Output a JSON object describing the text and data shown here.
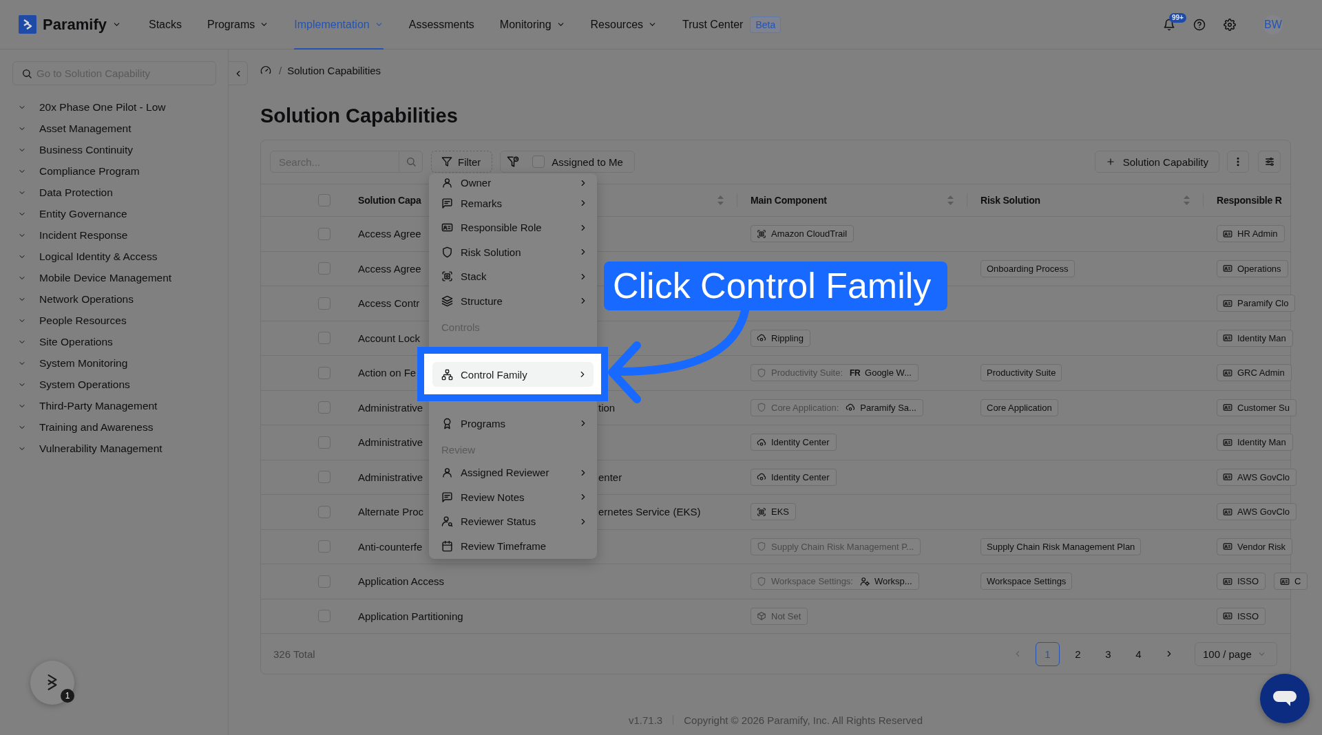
{
  "top_nav": {
    "brand": "Paramify",
    "items": [
      {
        "label": "Stacks",
        "has_menu": false,
        "selected": false
      },
      {
        "label": "Programs",
        "has_menu": true,
        "selected": false
      },
      {
        "label": "Implementation",
        "has_menu": true,
        "selected": true
      },
      {
        "label": "Assessments",
        "has_menu": false,
        "selected": false
      },
      {
        "label": "Monitoring",
        "has_menu": true,
        "selected": false
      },
      {
        "label": "Resources",
        "has_menu": true,
        "selected": false
      },
      {
        "label": "Trust Center",
        "has_menu": false,
        "selected": false,
        "badge": "Beta"
      }
    ],
    "notifications": "99+",
    "avatar": "BW"
  },
  "sidebar": {
    "search": {
      "placeholder": "Go to Solution Capability"
    },
    "items": [
      "20x Phase One Pilot - Low",
      "Asset Management",
      "Business Continuity",
      "Compliance Program",
      "Data Protection",
      "Entity Governance",
      "Incident Response",
      "Logical Identity & Access",
      "Mobile Device Management",
      "Network Operations",
      "People Resources",
      "Site Operations",
      "System Monitoring",
      "System Operations",
      "Third-Party Management",
      "Training and Awareness",
      "Vulnerability Management"
    ]
  },
  "breadcrumb": {
    "separator": "/",
    "current": "Solution Capabilities"
  },
  "page_title": "Solution Capabilities",
  "toolbar": {
    "search": {
      "placeholder": "Search..."
    },
    "filter": "Filter",
    "assigned_to_me": {
      "label": "Assigned to Me",
      "checked": false
    },
    "add_button": "Solution Capability"
  },
  "table": {
    "all_selected": false,
    "columns": [
      {
        "label": "Solution Capa",
        "sortable": true
      },
      {
        "label": "Main Component",
        "sortable": true
      },
      {
        "label": "Risk Solution",
        "sortable": true
      },
      {
        "label": "Responsible R",
        "sortable": false
      }
    ],
    "rows": [
      {
        "selected": false,
        "name": "Access Agree",
        "main_component": {
          "kind": "stack",
          "label": "Amazon CloudTrail"
        },
        "responsible": [
          "HR Admin"
        ]
      },
      {
        "selected": false,
        "name": "Access Agree",
        "risk_solution": "Onboarding Process",
        "responsible": [
          "Operations"
        ]
      },
      {
        "selected": false,
        "name": "Access Contr",
        "responsible": [
          "Paramify Clo"
        ]
      },
      {
        "selected": false,
        "name": "Account Lock",
        "main_component": {
          "kind": "app",
          "label": "Rippling"
        },
        "responsible": [
          "Identity Man"
        ]
      },
      {
        "selected": false,
        "name": "Action on Fe",
        "main_component": {
          "kind": "solution",
          "label": "Productivity Suite:",
          "target": {
            "kind": "logo",
            "mark": "FR",
            "label": "Google W..."
          }
        },
        "risk_solution": "Productivity Suite",
        "responsible": [
          "GRC Admin"
        ]
      },
      {
        "selected": false,
        "name": "Administrative",
        "name_end": "tion",
        "main_component": {
          "kind": "solution",
          "label": "Core Application:",
          "target": {
            "kind": "app",
            "label": "Paramify Sa..."
          }
        },
        "risk_solution": "Core Application",
        "responsible": [
          "Customer Su"
        ]
      },
      {
        "selected": false,
        "name": "Administrative",
        "main_component": {
          "kind": "app",
          "label": "Identity Center"
        },
        "responsible": [
          "Identity Man"
        ]
      },
      {
        "selected": false,
        "name": "Administrative",
        "name_end": "enter",
        "main_component": {
          "kind": "app",
          "label": "Identity Center"
        },
        "responsible": [
          "AWS GovClo"
        ]
      },
      {
        "selected": false,
        "name": "Alternate Proc",
        "name_end": "ernetes Service (EKS)",
        "main_component": {
          "kind": "stack",
          "label": "EKS"
        },
        "responsible": [
          "AWS GovClo"
        ]
      },
      {
        "selected": false,
        "name": "Anti-counterfe",
        "main_component": {
          "kind": "solution",
          "label": "Supply Chain Risk Management P..."
        },
        "risk_solution": "Supply Chain Risk Management Plan",
        "responsible": [
          "Vendor Risk"
        ]
      },
      {
        "selected": false,
        "name": "Application Access",
        "main_component": {
          "kind": "solution",
          "label": "Workspace Settings:",
          "target": {
            "kind": "team",
            "label": "Worksp..."
          }
        },
        "risk_solution": "Workspace Settings",
        "responsible": [
          "ISSO",
          "C"
        ]
      },
      {
        "selected": false,
        "name": "Application Partitioning",
        "main_component": {
          "kind": "unset",
          "label": "Not Set"
        },
        "responsible": [
          "ISSO"
        ]
      }
    ]
  },
  "pagination": {
    "total": "326 Total",
    "previous_disabled": true,
    "pages": [
      {
        "label": "1",
        "selected": true
      },
      {
        "label": "2",
        "selected": false
      },
      {
        "label": "3",
        "selected": false
      },
      {
        "label": "4",
        "selected": false
      }
    ],
    "page_size": "100 / page"
  },
  "filter_menu": {
    "items": [
      {
        "kind": "item",
        "label": "Owner",
        "submenu": true,
        "highlighted": false
      },
      {
        "kind": "item",
        "label": "Remarks",
        "submenu": true,
        "highlighted": false
      },
      {
        "kind": "item",
        "label": "Responsible Role",
        "submenu": true,
        "highlighted": false
      },
      {
        "kind": "item",
        "label": "Risk Solution",
        "submenu": true,
        "highlighted": false
      },
      {
        "kind": "item",
        "label": "Stack",
        "submenu": true,
        "highlighted": false
      },
      {
        "kind": "item",
        "label": "Structure",
        "submenu": true,
        "highlighted": false
      },
      {
        "kind": "group",
        "label": "Controls"
      },
      {
        "kind": "item",
        "label": "Control Family",
        "submenu": true,
        "highlighted": true
      },
      {
        "kind": "item",
        "label": "Programs",
        "submenu": true,
        "highlighted": false
      },
      {
        "kind": "group",
        "label": "Review"
      },
      {
        "kind": "item",
        "label": "Assigned Reviewer",
        "submenu": true,
        "highlighted": false
      },
      {
        "kind": "item",
        "label": "Review Notes",
        "submenu": true,
        "highlighted": false
      },
      {
        "kind": "item",
        "label": "Reviewer Status",
        "submenu": true,
        "highlighted": false
      },
      {
        "kind": "item",
        "label": "Review Timeframe",
        "submenu": false,
        "highlighted": false
      }
    ]
  },
  "tour": {
    "callout": "Click Control Family"
  },
  "footer": {
    "version": "v1.71.3",
    "copyright": "Copyright © 2026 Paramify, Inc. All Rights Reserved"
  },
  "help_launcher": {
    "badge": "1"
  }
}
